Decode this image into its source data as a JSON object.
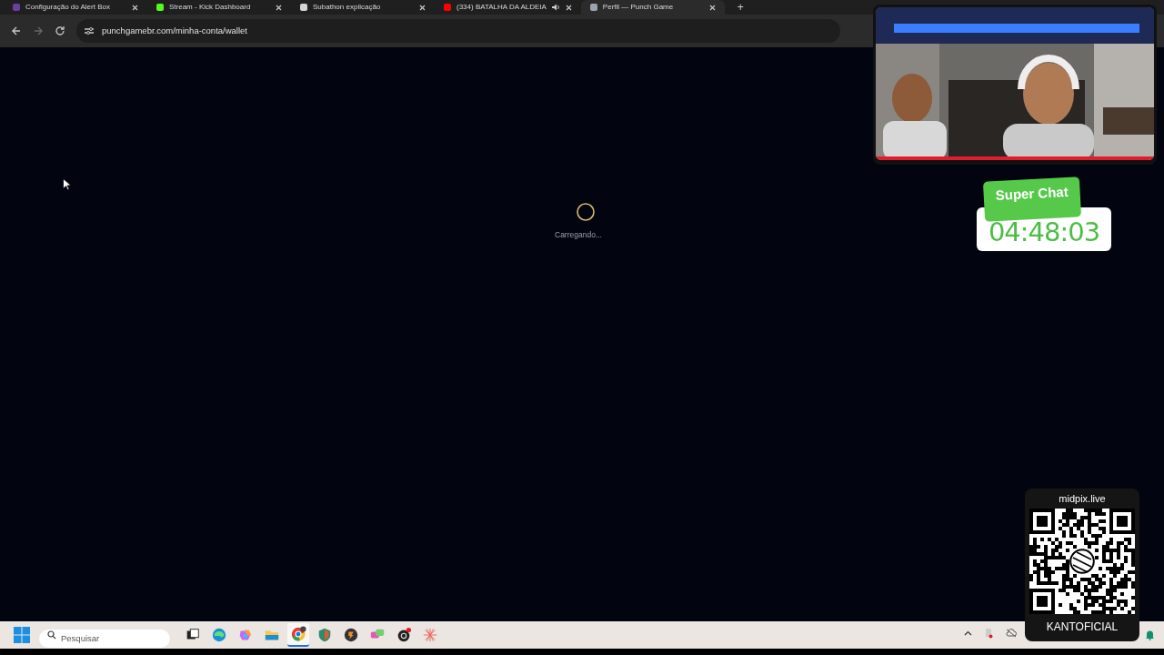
{
  "browser": {
    "tabs": [
      {
        "title": "Configuração do Alert Box",
        "kind": "alert",
        "audio": false,
        "selected": false
      },
      {
        "title": "Stream - Kick Dashboard",
        "kind": "kick",
        "audio": false,
        "selected": false
      },
      {
        "title": "Subathon explicação",
        "kind": "chat",
        "audio": false,
        "selected": false
      },
      {
        "title": "(334) BATALHA DA ALDEIA",
        "kind": "video",
        "audio": true,
        "selected": false
      },
      {
        "title": "Perfil — Punch Game",
        "kind": "punch",
        "audio": false,
        "selected": true
      }
    ],
    "new_tab": "+",
    "url": "punchgamebr.com/minha-conta/wallet"
  },
  "page": {
    "loading_text": "Carregando..."
  },
  "overlay": {
    "timer": {
      "label": "Super Chat",
      "time": "04:48:03"
    },
    "qr_card": {
      "title": "midpix.live",
      "caption": "KANTOFICIAL"
    }
  },
  "taskbar": {
    "search_placeholder": "Pesquisar",
    "apps": [
      {
        "kind": "taskview",
        "selected": false
      },
      {
        "kind": "edge",
        "selected": false
      },
      {
        "kind": "copilot",
        "selected": false
      },
      {
        "kind": "folder",
        "selected": false
      },
      {
        "kind": "chrome",
        "selected": true
      },
      {
        "kind": "shield",
        "selected": false
      },
      {
        "kind": "fruit",
        "selected": false
      },
      {
        "kind": "chat",
        "selected": false
      },
      {
        "kind": "obs",
        "selected": false
      },
      {
        "kind": "spark",
        "selected": false
      }
    ]
  }
}
